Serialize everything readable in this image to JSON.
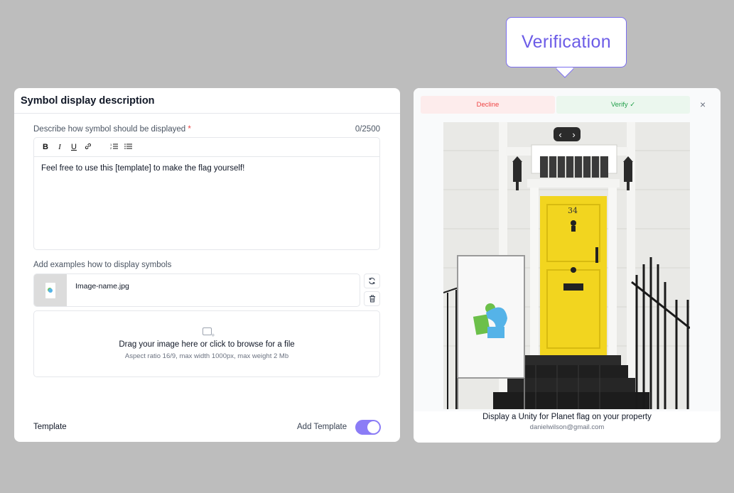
{
  "callout": {
    "label": "Verification"
  },
  "left_panel": {
    "title": "Symbol display description",
    "description_label": "Describe how symbol should be displayed",
    "required_mark": "*",
    "char_count": "0/2500",
    "toolbar": [
      "B",
      "I",
      "U",
      "link-icon",
      "ordered-list-icon",
      "bullet-list-icon"
    ],
    "editor_text": "Feel free to use this [template] to make the flag yourself!",
    "examples_label": "Add examples how to display symbols",
    "file_name": "Image-name.jpg",
    "dropzone": {
      "title": "Drag your image here or click to browse for a file",
      "subtitle": "Aspect ratio 16/9, max width 1000px,  max weight 2 Mb"
    },
    "template_label": "Template",
    "add_template_label": "Add Template",
    "add_template_on": true
  },
  "right_panel": {
    "decline_label": "Decline",
    "verify_label": "Verify",
    "verify_check": "✓",
    "close_icon": "×",
    "nav_prev": "‹",
    "nav_next": "›",
    "door_number": "34",
    "caption": "Display a Unity for Planet flag on your property",
    "email": "danielwilson@gmail.com"
  },
  "colors": {
    "accent": "#6c5ce7",
    "toggle": "#8b7cf6",
    "decline_bg": "#fdecec",
    "decline_text": "#ef4444",
    "verify_bg": "#ebf7ee",
    "verify_text": "#22a04b",
    "door": "#f2d51f"
  }
}
